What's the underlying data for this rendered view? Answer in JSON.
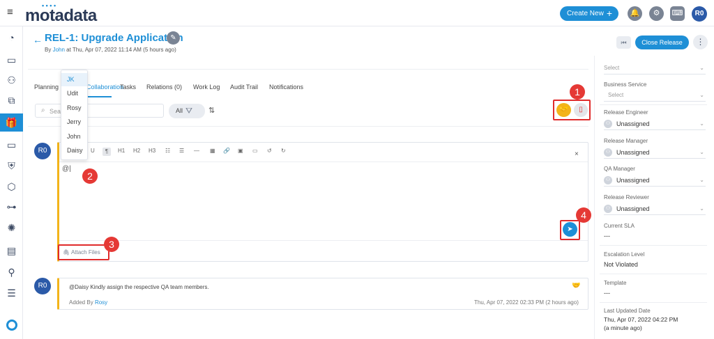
{
  "topbar": {
    "brand": "motadata",
    "create_label": "Create New",
    "user_initials": "R0"
  },
  "header": {
    "title": "REL-1: Upgrade Application",
    "by_prefix": "By",
    "author": "John",
    "by_suffix": "at Thu, Apr 07, 2022 11:14 AM (5 hours ago)",
    "close_label": "Close Release"
  },
  "tabs": [
    {
      "label": "Planning"
    },
    {
      "label": "Collaboration"
    },
    {
      "label": "Tasks"
    },
    {
      "label": "Relations (0)"
    },
    {
      "label": "Work Log"
    },
    {
      "label": "Audit Trail"
    },
    {
      "label": "Notifications"
    }
  ],
  "toolbar": {
    "search_placeholder": "Sear",
    "filter_label": "All"
  },
  "mention_dropdown": {
    "items": [
      "JK",
      "Udit",
      "Rosy",
      "Jerry",
      "John",
      "Daisy"
    ],
    "selected": "JK"
  },
  "editor": {
    "avatar": "R0",
    "tools": [
      "U",
      "¶",
      "H1",
      "H2",
      "H3"
    ],
    "text": "@|",
    "attach_label": "Attach Files"
  },
  "comment": {
    "avatar": "R0",
    "text": "@Daisy Kindly assign the respective QA team members.",
    "added_prefix": "Added By",
    "added_by": "Rosy",
    "time": "Thu, Apr 07, 2022 02:33 PM (2 hours ago)"
  },
  "badges": [
    "1",
    "2",
    "3",
    "4"
  ],
  "right_panel": {
    "top_select": "Select",
    "business_service_label": "Business Service",
    "business_service_value": "Select",
    "release_engineer_label": "Release Engineer",
    "release_engineer_value": "Unassigned",
    "release_manager_label": "Release Manager",
    "release_manager_value": "Unassigned",
    "qa_manager_label": "QA Manager",
    "qa_manager_value": "Unassigned",
    "release_reviewer_label": "Release Reviewer",
    "release_reviewer_value": "Unassigned",
    "current_sla_label": "Current SLA",
    "current_sla_value": "---",
    "escalation_label": "Escalation Level",
    "escalation_value": "Not Violated",
    "template_label": "Template",
    "template_value": "---",
    "last_updated_label": "Last Updated Date",
    "last_updated_value": "Thu, Apr 07, 2022 04:22 PM",
    "last_updated_ago": "(a minute ago)"
  },
  "colors": {
    "accent": "#1e8fd6",
    "highlight": "#e02b2b",
    "yellow": "#f3b41a"
  }
}
